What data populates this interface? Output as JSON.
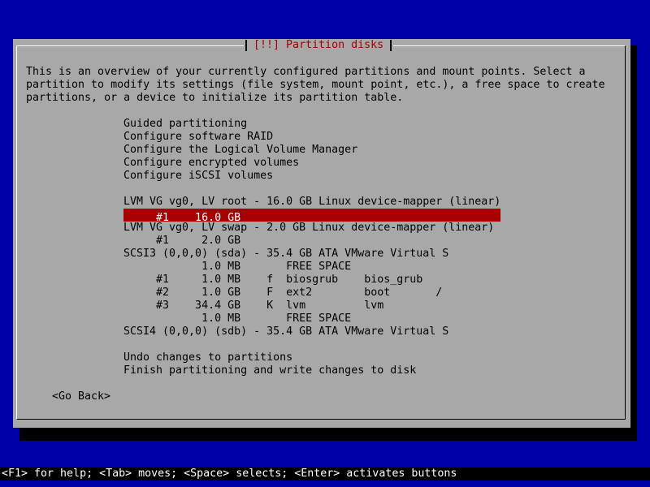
{
  "dialog": {
    "title": "[!!] Partition disks",
    "intro": [
      "This is an overview of your currently configured partitions and mount points. Select a",
      "partition to modify its settings (file system, mount point, etc.), a free space to create",
      "partitions, or a device to initialize its partition table."
    ],
    "menu": [
      "Guided partitioning",
      "Configure software RAID",
      "Configure the Logical Volume Manager",
      "Configure encrypted volumes",
      "Configure iSCSI volumes",
      "",
      "LVM VG vg0, LV root - 16.0 GB Linux device-mapper (linear)",
      "     #1    16.0 GB",
      "LVM VG vg0, LV swap - 2.0 GB Linux device-mapper (linear)",
      "     #1     2.0 GB",
      "SCSI3 (0,0,0) (sda) - 35.4 GB ATA VMware Virtual S",
      "            1.0 MB       FREE SPACE",
      "     #1     1.0 MB    f  biosgrub    bios_grub",
      "     #2     1.0 GB    F  ext2        boot       /",
      "     #3    34.4 GB    K  lvm         lvm",
      "            1.0 MB       FREE SPACE",
      "SCSI4 (0,0,0) (sdb) - 35.4 GB ATA VMware Virtual S",
      "",
      "Undo changes to partitions",
      "Finish partitioning and write changes to disk"
    ],
    "selected_index": 7,
    "go_back": "<Go Back>"
  },
  "footer": {
    "help": "<F1> for help; <Tab> moves; <Space> selects; <Enter> activates buttons"
  },
  "colors": {
    "background": "#0000a8",
    "dialog": "#a8a8a8",
    "selection": "#a80000",
    "title": "#a80000"
  }
}
